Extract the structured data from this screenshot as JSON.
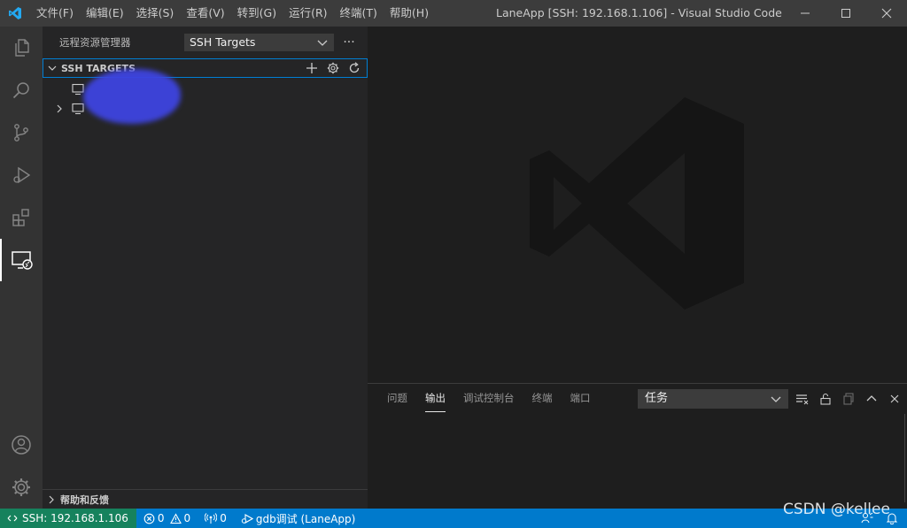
{
  "window": {
    "title": "LaneApp [SSH: 192.168.1.106] - Visual Studio Code",
    "menu": [
      "文件(F)",
      "编辑(E)",
      "选择(S)",
      "查看(V)",
      "转到(G)",
      "运行(R)",
      "终端(T)",
      "帮助(H)"
    ]
  },
  "sidebar": {
    "title": "远程资源管理器",
    "dropdown_value": "SSH Targets",
    "more_label": "···",
    "section_title": "SSH TARGETS",
    "help_section": "帮助和反馈"
  },
  "panel": {
    "tabs": [
      "问题",
      "输出",
      "调试控制台",
      "终端",
      "端口"
    ],
    "active_tab": 1,
    "output_channel": "任务"
  },
  "statusbar": {
    "remote": "SSH: 192.168.1.106",
    "errors": "0",
    "warnings": "0",
    "ports": "0",
    "debug": "gdb调试 (LaneApp)"
  },
  "watermark_text": "CSDN @kellee",
  "colors": {
    "titlebar": "#3c3c3c",
    "activitybar": "#333333",
    "sidebar": "#252526",
    "editor": "#1e1e1e",
    "statusbar": "#007acc",
    "remote": "#16825d",
    "focus_border": "#007fd4"
  }
}
